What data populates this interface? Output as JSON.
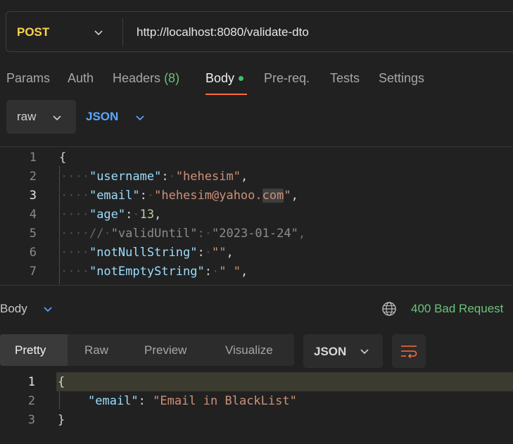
{
  "request": {
    "method": "POST",
    "url": "http://localhost:8080/validate-dto"
  },
  "tabs": [
    {
      "label": "Params"
    },
    {
      "label": "Auth"
    },
    {
      "label": "Headers",
      "count": "(8)"
    },
    {
      "label": "Body"
    },
    {
      "label": "Pre-req."
    },
    {
      "label": "Tests"
    },
    {
      "label": "Settings"
    }
  ],
  "body_mode": {
    "format": "raw",
    "language": "JSON"
  },
  "request_body": {
    "line_numbers": [
      "1",
      "2",
      "3",
      "4",
      "5",
      "6",
      "7"
    ],
    "brace_open": "{",
    "username_key": "\"username\"",
    "username_val": "\"hehesim\"",
    "email_key": "\"email\"",
    "email_val_pre": "\"hehesim@yahoo.",
    "email_val_hl": "com",
    "email_val_post": "\"",
    "age_key": "\"age\"",
    "age_val": "13",
    "comment_slash": "//",
    "valid_key": "\"validUntil\"",
    "valid_val": "\"2023-01-24\"",
    "notnull_key": "\"notNullString\"",
    "notnull_val": "\"\"",
    "notempty_key": "\"notEmptyString\"",
    "notempty_val": "\" \"",
    "comma": ",",
    "colon": ":",
    "indent_dots": "····"
  },
  "response": {
    "section_label": "Body",
    "status": "400 Bad Request",
    "view_tabs": [
      {
        "label": "Pretty"
      },
      {
        "label": "Raw"
      },
      {
        "label": "Preview"
      },
      {
        "label": "Visualize"
      }
    ],
    "format": "JSON",
    "line_numbers": [
      "1",
      "2",
      "3"
    ],
    "brace_open": "{",
    "brace_close": "}",
    "email_key": "\"email\"",
    "email_val": "\"Email in BlackList\""
  },
  "colors": {
    "method": "#ffd24a",
    "accent_tab": "#ff6c37",
    "status_ok_green": "#6bc17a",
    "link_blue": "#5aa9ff",
    "wrap_icon": "#ff6c37"
  },
  "icons": {
    "method_dropdown": "chevron-down-icon",
    "format_dropdown": "chevron-down-icon",
    "globe": "globe-icon",
    "wrap": "wrap-lines-icon"
  }
}
